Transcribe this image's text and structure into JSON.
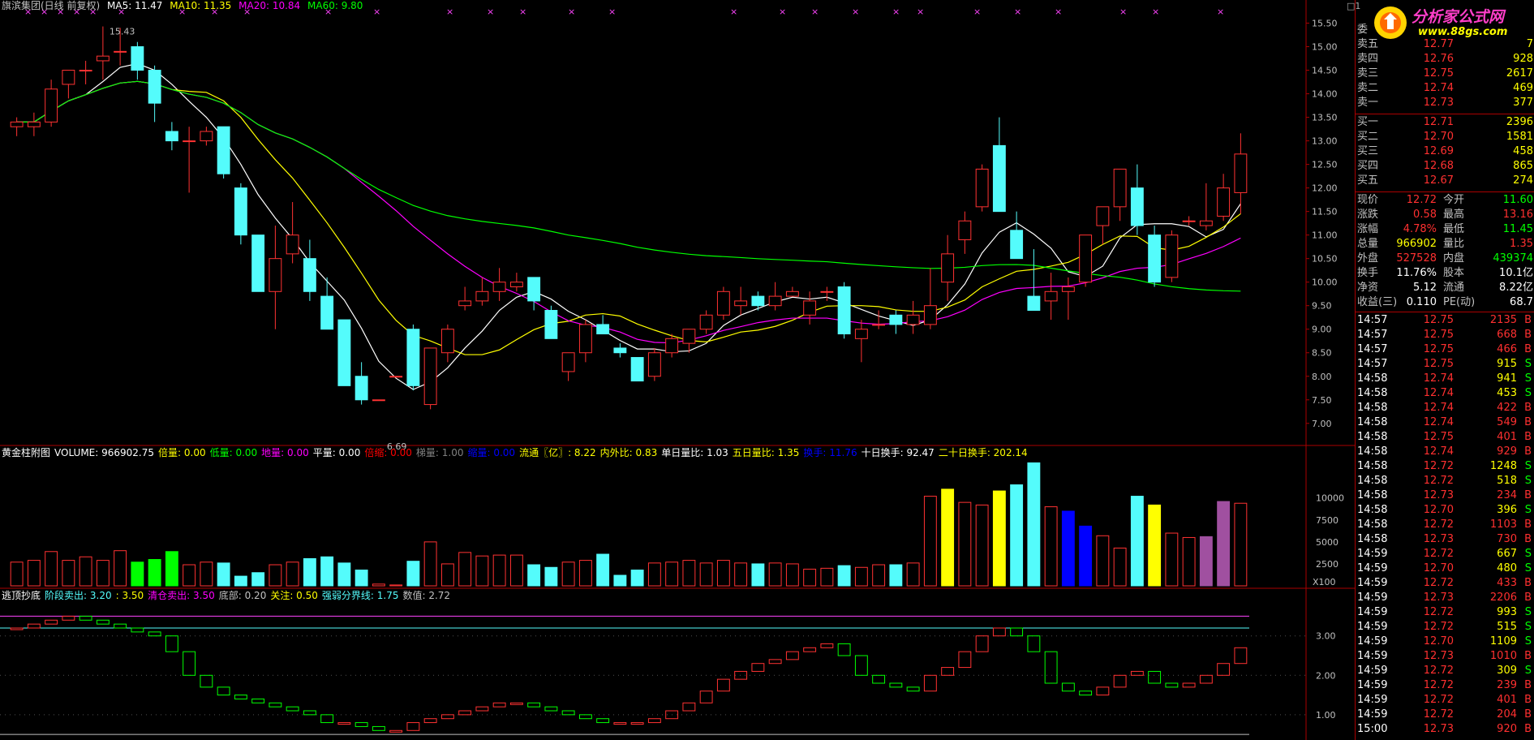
{
  "stock": {
    "title": "旗滨集团(日线 前复权)",
    "ma": [
      {
        "label": "MA5: 11.47",
        "color": "#ffffff"
      },
      {
        "label": "MA10: 11.35",
        "color": "#ffff00"
      },
      {
        "label": "MA20: 10.84",
        "color": "#ff00ff"
      },
      {
        "label": "MA60: 9.80",
        "color": "#00ff00"
      }
    ],
    "high_label": "15.43",
    "low_label": "6.69",
    "price_axis": [
      "15.50",
      "15.00",
      "14.50",
      "14.00",
      "13.50",
      "13.00",
      "12.50",
      "12.00",
      "11.50",
      "11.00",
      "10.50",
      "10.00",
      "9.50",
      "9.00",
      "8.50",
      "8.00",
      "7.50",
      "7.00"
    ],
    "volume_axis": [
      "10000",
      "7500",
      "5000",
      "2500"
    ],
    "volume_unit": "X100",
    "ind_axis": [
      "3.00",
      "2.00",
      "1.00"
    ],
    "top_right_num": "1"
  },
  "volume_header": [
    {
      "t": "黄金柱附图",
      "c": "#ffffff"
    },
    {
      "t": "VOLUME: 966902.75",
      "c": "#ffffff"
    },
    {
      "t": "倍量: 0.00",
      "c": "#ffff00"
    },
    {
      "t": "低量: 0.00",
      "c": "#00ff00"
    },
    {
      "t": "地量: 0.00",
      "c": "#ff00ff"
    },
    {
      "t": "平量: 0.00",
      "c": "#ffffff"
    },
    {
      "t": "倍缩: 0.00",
      "c": "#ff0000"
    },
    {
      "t": "梯量: 1.00",
      "c": "#808080"
    },
    {
      "t": "缩量: 0.00",
      "c": "#0000ff"
    },
    {
      "t": "流通〖亿〗: 8.22",
      "c": "#ffff00"
    },
    {
      "t": "内外比: 0.83",
      "c": "#ffff00"
    },
    {
      "t": "单日量比: 1.03",
      "c": "#ffffff"
    },
    {
      "t": "五日量比: 1.35",
      "c": "#ffff00"
    },
    {
      "t": "换手: 11.76",
      "c": "#0000ff"
    },
    {
      "t": "十日换手: 92.47",
      "c": "#ffffff"
    },
    {
      "t": "二十日换手: 202.14",
      "c": "#ffff00"
    }
  ],
  "ind_header": [
    {
      "t": "逃顶抄底",
      "c": "#ffffff"
    },
    {
      "t": "阶段卖出: 3.20",
      "c": "#54fcfc"
    },
    {
      "t": ": 3.50",
      "c": "#ffff00"
    },
    {
      "t": "清仓卖出: 3.50",
      "c": "#ff00ff"
    },
    {
      "t": "底部: 0.20",
      "c": "#c0c0c0"
    },
    {
      "t": "关注: 0.50",
      "c": "#ffff00"
    },
    {
      "t": "强弱分界线: 1.75",
      "c": "#54fcfc"
    },
    {
      "t": "数值: 2.72",
      "c": "#c0c0c0"
    }
  ],
  "orderbook": {
    "asks": [
      {
        "label": "委",
        "price": "",
        "vol": ""
      },
      {
        "label": "卖五",
        "price": "12.77",
        "vol": "7"
      },
      {
        "label": "卖四",
        "price": "12.76",
        "vol": "928"
      },
      {
        "label": "卖三",
        "price": "12.75",
        "vol": "2617"
      },
      {
        "label": "卖二",
        "price": "12.74",
        "vol": "469"
      },
      {
        "label": "卖一",
        "price": "12.73",
        "vol": "377"
      }
    ],
    "bids": [
      {
        "label": "买一",
        "price": "12.71",
        "vol": "2396"
      },
      {
        "label": "买二",
        "price": "12.70",
        "vol": "1581"
      },
      {
        "label": "买三",
        "price": "12.69",
        "vol": "458"
      },
      {
        "label": "买四",
        "price": "12.68",
        "vol": "865"
      },
      {
        "label": "买五",
        "price": "12.67",
        "vol": "274"
      }
    ]
  },
  "quote": [
    {
      "l1": "现价",
      "v1": "12.72",
      "c1": "#ff3030",
      "l2": "今开",
      "v2": "11.60",
      "c2": "#00ff00"
    },
    {
      "l1": "涨跌",
      "v1": "0.58",
      "c1": "#ff3030",
      "l2": "最高",
      "v2": "13.16",
      "c2": "#ff3030"
    },
    {
      "l1": "涨幅",
      "v1": "4.78%",
      "c1": "#ff3030",
      "l2": "最低",
      "v2": "11.45",
      "c2": "#00ff00"
    },
    {
      "l1": "总量",
      "v1": "966902",
      "c1": "#ffff00",
      "l2": "量比",
      "v2": "1.35",
      "c2": "#ff3030"
    },
    {
      "l1": "外盘",
      "v1": "527528",
      "c1": "#ff3030",
      "l2": "内盘",
      "v2": "439374",
      "c2": "#00ff00"
    },
    {
      "l1": "换手",
      "v1": "11.76%",
      "c1": "#ffffff",
      "l2": "股本",
      "v2": "10.1亿",
      "c2": "#ffffff"
    },
    {
      "l1": "净资",
      "v1": "5.12",
      "c1": "#ffffff",
      "l2": "流通",
      "v2": "8.22亿",
      "c2": "#ffffff"
    },
    {
      "l1": "收益(三)",
      "v1": "0.110",
      "c1": "#ffffff",
      "l2": "PE(动)",
      "v2": "68.7",
      "c2": "#ffffff"
    }
  ],
  "ticks": [
    {
      "t": "14:57",
      "p": "12.75",
      "v": "2135",
      "s": "B"
    },
    {
      "t": "14:57",
      "p": "12.75",
      "v": "668",
      "s": "B"
    },
    {
      "t": "14:57",
      "p": "12.75",
      "v": "466",
      "s": "B"
    },
    {
      "t": "14:57",
      "p": "12.75",
      "v": "915",
      "s": "S"
    },
    {
      "t": "14:58",
      "p": "12.74",
      "v": "941",
      "s": "S"
    },
    {
      "t": "14:58",
      "p": "12.74",
      "v": "453",
      "s": "S"
    },
    {
      "t": "14:58",
      "p": "12.74",
      "v": "422",
      "s": "B"
    },
    {
      "t": "14:58",
      "p": "12.74",
      "v": "549",
      "s": "B"
    },
    {
      "t": "14:58",
      "p": "12.75",
      "v": "401",
      "s": "B"
    },
    {
      "t": "14:58",
      "p": "12.74",
      "v": "929",
      "s": "B"
    },
    {
      "t": "14:58",
      "p": "12.72",
      "v": "1248",
      "s": "S"
    },
    {
      "t": "14:58",
      "p": "12.72",
      "v": "518",
      "s": "S"
    },
    {
      "t": "14:58",
      "p": "12.73",
      "v": "234",
      "s": "B"
    },
    {
      "t": "14:58",
      "p": "12.70",
      "v": "396",
      "s": "S"
    },
    {
      "t": "14:58",
      "p": "12.72",
      "v": "1103",
      "s": "B"
    },
    {
      "t": "14:58",
      "p": "12.73",
      "v": "730",
      "s": "B"
    },
    {
      "t": "14:59",
      "p": "12.72",
      "v": "667",
      "s": "S"
    },
    {
      "t": "14:59",
      "p": "12.70",
      "v": "480",
      "s": "S"
    },
    {
      "t": "14:59",
      "p": "12.72",
      "v": "433",
      "s": "B"
    },
    {
      "t": "14:59",
      "p": "12.73",
      "v": "2206",
      "s": "B"
    },
    {
      "t": "14:59",
      "p": "12.72",
      "v": "993",
      "s": "S"
    },
    {
      "t": "14:59",
      "p": "12.72",
      "v": "515",
      "s": "S"
    },
    {
      "t": "14:59",
      "p": "12.70",
      "v": "1109",
      "s": "S"
    },
    {
      "t": "14:59",
      "p": "12.73",
      "v": "1010",
      "s": "B"
    },
    {
      "t": "14:59",
      "p": "12.72",
      "v": "309",
      "s": "S"
    },
    {
      "t": "14:59",
      "p": "12.72",
      "v": "239",
      "s": "B"
    },
    {
      "t": "14:59",
      "p": "12.72",
      "v": "401",
      "s": "B"
    },
    {
      "t": "14:59",
      "p": "12.72",
      "v": "204",
      "s": "B"
    },
    {
      "t": "15:00",
      "p": "12.73",
      "v": "920",
      "s": "B"
    }
  ],
  "logo": {
    "name": "分析家公式网",
    "url": "www.88gs.com"
  },
  "colors": {
    "up": "#ff3232",
    "down": "#54fcfc",
    "bg": "#000000",
    "grid": "#aa0000",
    "gold": "#ffff00",
    "flat": "#ffffff",
    "low": "#00ff00",
    "shrink": "#0000ff",
    "purple": "#a050a0"
  },
  "chart_data": {
    "type": "candlestick",
    "candles": [
      [
        13.3,
        13.5,
        13.1,
        13.4
      ],
      [
        13.3,
        13.6,
        13.1,
        13.4
      ],
      [
        13.4,
        14.3,
        13.3,
        14.1
      ],
      [
        14.2,
        14.5,
        13.9,
        14.5
      ],
      [
        14.5,
        14.7,
        14.2,
        14.5
      ],
      [
        14.7,
        15.43,
        14.3,
        14.8
      ],
      [
        14.9,
        15.4,
        14.6,
        14.9
      ],
      [
        15.0,
        15.1,
        14.3,
        14.5
      ],
      [
        14.5,
        14.6,
        13.4,
        13.8
      ],
      [
        13.2,
        13.4,
        12.8,
        13.0
      ],
      [
        13.0,
        13.3,
        11.9,
        13.0
      ],
      [
        13.0,
        13.3,
        12.9,
        13.2
      ],
      [
        13.3,
        13.3,
        12.2,
        12.3
      ],
      [
        12.0,
        12.1,
        10.8,
        11.0
      ],
      [
        11.0,
        11.0,
        9.8,
        9.8
      ],
      [
        9.8,
        11.2,
        9.0,
        10.5
      ],
      [
        10.6,
        11.7,
        10.4,
        11.0
      ],
      [
        10.5,
        10.9,
        9.6,
        9.8
      ],
      [
        9.7,
        10.1,
        9.1,
        9.0
      ],
      [
        9.2,
        9.2,
        8.7,
        7.8
      ],
      [
        8.0,
        8.3,
        7.4,
        7.5
      ],
      [
        7.5,
        7.5,
        7.5,
        7.5
      ],
      [
        8.0,
        8.0,
        8.0,
        8.0
      ],
      [
        9.0,
        9.1,
        7.7,
        7.8
      ],
      [
        7.4,
        8.6,
        7.3,
        8.6
      ],
      [
        8.5,
        9.1,
        8.3,
        9.0
      ],
      [
        9.5,
        9.9,
        9.4,
        9.6
      ],
      [
        9.6,
        10.1,
        9.5,
        9.8
      ],
      [
        9.8,
        10.3,
        9.6,
        10.0
      ],
      [
        9.9,
        10.2,
        9.8,
        10.0
      ],
      [
        10.1,
        10.1,
        9.4,
        9.6
      ],
      [
        9.4,
        9.5,
        8.8,
        8.8
      ],
      [
        8.1,
        8.4,
        7.9,
        8.5
      ],
      [
        8.5,
        9.2,
        8.3,
        9.1
      ],
      [
        9.1,
        9.3,
        8.9,
        8.9
      ],
      [
        8.6,
        8.7,
        8.4,
        8.5
      ],
      [
        8.4,
        8.4,
        8.0,
        7.9
      ],
      [
        8.0,
        8.6,
        7.9,
        8.5
      ],
      [
        8.5,
        8.9,
        8.4,
        8.8
      ],
      [
        8.7,
        9.0,
        8.5,
        9.0
      ],
      [
        9.0,
        9.4,
        8.9,
        9.3
      ],
      [
        9.3,
        9.9,
        9.2,
        9.8
      ],
      [
        9.5,
        9.9,
        9.3,
        9.6
      ],
      [
        9.7,
        9.8,
        9.4,
        9.5
      ],
      [
        9.5,
        10.0,
        9.4,
        9.7
      ],
      [
        9.7,
        9.9,
        9.7,
        9.8
      ],
      [
        9.3,
        9.8,
        9.1,
        9.6
      ],
      [
        9.8,
        9.9,
        9.6,
        9.8
      ],
      [
        9.9,
        10.0,
        8.8,
        8.9
      ],
      [
        8.8,
        9.2,
        8.3,
        9.0
      ],
      [
        9.1,
        9.4,
        9.0,
        9.1
      ],
      [
        9.3,
        9.4,
        8.9,
        9.1
      ],
      [
        9.1,
        9.6,
        8.9,
        9.3
      ],
      [
        9.1,
        10.3,
        9.0,
        9.5
      ],
      [
        10.0,
        11.0,
        9.6,
        10.6
      ],
      [
        10.9,
        11.5,
        10.6,
        11.3
      ],
      [
        11.6,
        12.5,
        11.5,
        12.4
      ],
      [
        12.9,
        13.5,
        12.0,
        11.5
      ],
      [
        11.1,
        11.5,
        10.5,
        10.5
      ],
      [
        9.7,
        10.7,
        9.5,
        9.4
      ],
      [
        9.6,
        10.2,
        9.2,
        9.8
      ],
      [
        9.8,
        10.1,
        9.2,
        9.9
      ],
      [
        10.0,
        11.0,
        9.9,
        11.0
      ],
      [
        11.2,
        11.6,
        10.8,
        11.6
      ],
      [
        11.6,
        12.3,
        11.3,
        12.4
      ],
      [
        12.0,
        12.5,
        11.0,
        11.2
      ],
      [
        11.0,
        11.2,
        9.9,
        10.0
      ],
      [
        10.1,
        11.1,
        10.0,
        11.0
      ],
      [
        11.3,
        11.4,
        11.2,
        11.3
      ],
      [
        11.2,
        12.1,
        11.1,
        11.3
      ],
      [
        11.4,
        12.3,
        11.3,
        12.0
      ],
      [
        11.9,
        13.16,
        11.45,
        12.72
      ]
    ],
    "volume": [
      2700,
      2900,
      3900,
      2900,
      3300,
      2900,
      4000,
      2700,
      3000,
      3900,
      2400,
      2700,
      2600,
      1100,
      1500,
      2400,
      2700,
      3100,
      3300,
      2600,
      1800,
      200,
      100,
      2800,
      5000,
      2500,
      3800,
      3400,
      3500,
      3500,
      2400,
      2100,
      2700,
      2900,
      3600,
      1200,
      1800,
      2600,
      2700,
      2900,
      2600,
      2900,
      2600,
      2500,
      2600,
      2500,
      1900,
      2000,
      2300,
      2100,
      2400,
      2400,
      2600,
      10200,
      11000,
      9500,
      9200,
      10800,
      11500,
      14000,
      9000,
      8500,
      6800,
      5700,
      4300,
      10200,
      9200,
      6000,
      5500,
      5600,
      9600,
      9400
    ],
    "indicator": [
      3.2,
      3.3,
      3.4,
      3.5,
      3.4,
      3.3,
      3.2,
      3.1,
      3.0,
      2.6,
      2.0,
      1.7,
      1.5,
      1.4,
      1.3,
      1.2,
      1.1,
      1.0,
      0.8,
      0.8,
      0.7,
      0.6,
      0.6,
      0.8,
      0.9,
      1.0,
      1.1,
      1.2,
      1.3,
      1.3,
      1.2,
      1.1,
      1.0,
      0.9,
      0.8,
      0.8,
      0.8,
      0.9,
      1.1,
      1.3,
      1.6,
      1.9,
      2.1,
      2.3,
      2.4,
      2.6,
      2.7,
      2.8,
      2.5,
      2.0,
      1.8,
      1.7,
      1.6,
      2.0,
      2.2,
      2.6,
      3.0,
      3.2,
      3.0,
      2.6,
      1.8,
      1.6,
      1.5,
      1.7,
      2.0,
      2.1,
      1.8,
      1.7,
      1.8,
      2.0,
      2.3,
      2.7
    ],
    "y_range": [
      6.6,
      15.75
    ],
    "volume_max": 14500,
    "indicator_range": [
      0.4,
      3.9
    ],
    "indicator_levels": [
      3.5,
      3.2,
      0.5,
      0.2
    ]
  }
}
